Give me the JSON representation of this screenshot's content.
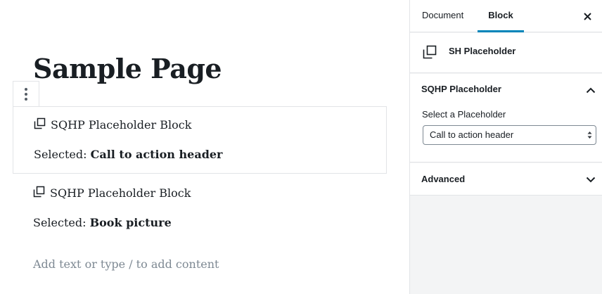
{
  "editor": {
    "page_title": "Sample Page",
    "blocks": [
      {
        "title": "SQHP Placeholder Block",
        "selected_label": "Selected:",
        "selected_value": "Call to action header",
        "icon": "duplicate-block-icon"
      },
      {
        "title": "SQHP Placeholder Block",
        "selected_label": "Selected:",
        "selected_value": "Book picture",
        "icon": "duplicate-block-icon"
      }
    ],
    "appender_placeholder": "Add text or type / to add content",
    "toolbar_icon": "more-vertical-icon"
  },
  "sidebar": {
    "tabs": [
      {
        "label": "Document",
        "active": false
      },
      {
        "label": "Block",
        "active": true
      }
    ],
    "close_icon": "close-icon",
    "block_card": {
      "name": "SH Placeholder",
      "icon": "duplicate-block-icon"
    },
    "panel": {
      "title": "SQHP Placeholder",
      "expanded": true,
      "field_label": "Select a Placeholder",
      "select_value": "Call to action header"
    },
    "advanced": {
      "title": "Advanced",
      "expanded": false
    }
  },
  "colors": {
    "accent": "#0085ba",
    "sidebar_bg": "#f3f4f5",
    "border": "#e2e4e7",
    "placeholder_text": "#7e8993"
  }
}
